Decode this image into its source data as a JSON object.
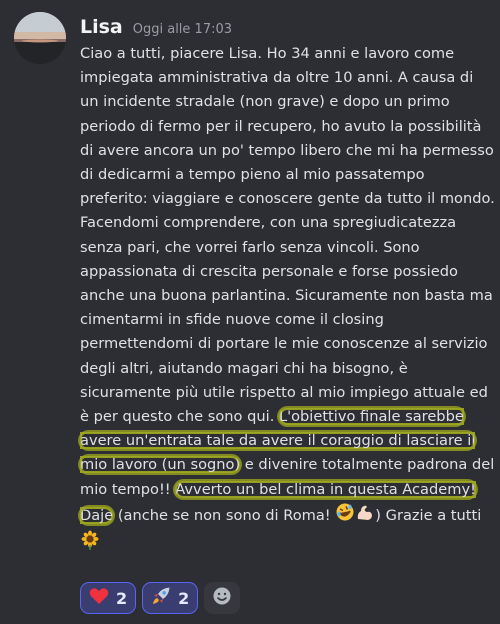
{
  "message": {
    "username": "Lisa",
    "timestamp": "Oggi alle 17:03",
    "text_before_highlight": "Ciao a tutti, piacere Lisa. Ho 34 anni e lavoro come impiegata amministrativa da oltre 10 anni. A causa di un incidente stradale (non grave) e dopo un primo periodo di fermo per il recupero, ho avuto la possibilità di avere ancora un po' tempo libero che mi ha permesso di dedicarmi a tempo pieno al mio passatempo preferito: viaggiare e conoscere gente da tutto il mondo. Facendomi comprendere, con una spregiudicatezza senza pari, che vorrei farlo senza vincoli. Sono appassionata di crescita personale e forse possiedo anche una buona parlantina. Sicuramente non basta ma cimentarmi in sfide nuove come il closing permettendomi di portare le mie conoscenze al servizio degli altri, aiutando magari chi ha bisogno, è sicuramente più utile rispetto al mio impiego attuale ed è per questo che sono qui. ",
    "highlight_1": "L'obiettivo finale sarebbe avere un'entrata tale da avere il coraggio di lasciare il mio lavoro (un sogno)",
    "text_middle": " e divenire totalmente padrona del mio tempo!! ",
    "highlight_2": "Avverto un bel clima in questa Academy! Daje",
    "text_after_highlight": " (anche se non sono di Roma! ",
    "text_closing": ") Grazie a tutti ",
    "emojis": [
      "rolling-on-floor-laughing",
      "flexed-biceps",
      "sunflower"
    ],
    "highlight_color": "#a8b02a"
  },
  "reactions": [
    {
      "emoji": "red-heart",
      "count": "2"
    },
    {
      "emoji": "rocket",
      "count": "2"
    }
  ],
  "add_reaction_icon": "add-reaction-smiley-icon",
  "colors": {
    "background": "#2d2e33",
    "username": "#f2f3f5",
    "timestamp": "#9a9ca3",
    "reaction_bg": "#3a3d70",
    "reaction_border": "#5865f2"
  }
}
